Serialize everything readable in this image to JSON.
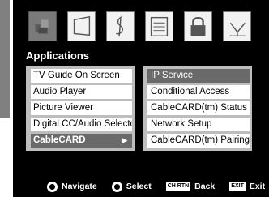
{
  "tabs": [
    {
      "name": "applications-tab",
      "icon": "app-blocks-icon"
    },
    {
      "name": "picture-tab",
      "icon": "screen-icon"
    },
    {
      "name": "sound-tab",
      "icon": "music-clef-icon"
    },
    {
      "name": "preferences-tab",
      "icon": "checklist-icon"
    },
    {
      "name": "locks-tab",
      "icon": "padlock-icon"
    },
    {
      "name": "setup-tab",
      "icon": "antenna-icon"
    }
  ],
  "menu": {
    "title": "Applications",
    "items": [
      "TV Guide On Screen",
      "Audio Player",
      "Picture Viewer",
      "Digital CC/Audio Selector",
      "CableCARD"
    ],
    "selected_arrow": "▶"
  },
  "submenu": {
    "items": [
      "IP Service",
      "Conditional Access",
      "CableCARD(tm) Status",
      "Network Setup",
      "CableCARD(tm) Pairing"
    ]
  },
  "footer": {
    "navigate": "Navigate",
    "select": "Select",
    "back_key": "CH RTN",
    "back": "Back",
    "exit_key": "EXIT",
    "exit": "Exit"
  },
  "colors": {
    "panel": "#000000",
    "highlight": "#6a6a6a",
    "menu_bg": "#bdbdbd"
  }
}
